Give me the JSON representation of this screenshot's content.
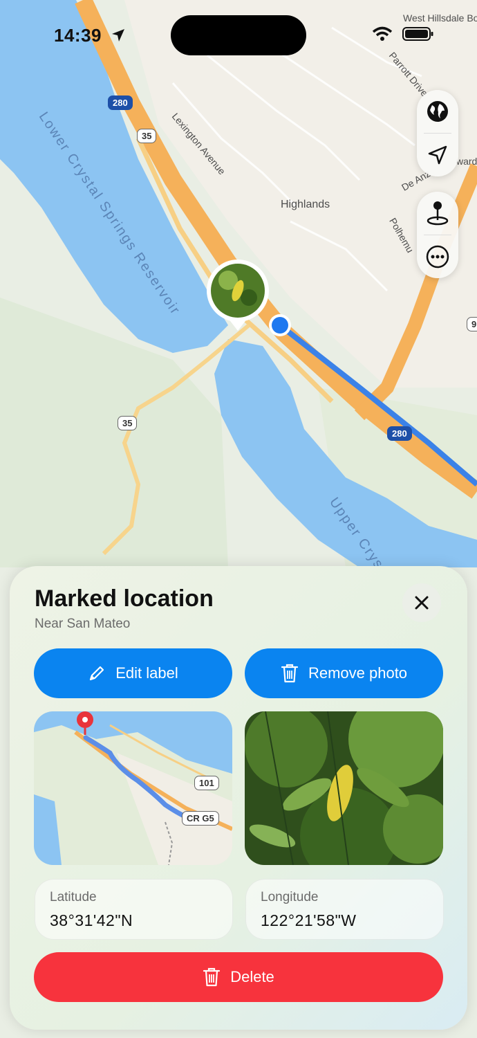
{
  "status_bar": {
    "time": "14:39"
  },
  "map": {
    "water_labels": [
      "Lower Crystal Springs Reservoir",
      "Upper Crys"
    ],
    "place_labels": [
      "Highlands",
      "Lexington Avenue",
      "West Hillsdale Bo",
      "Parrott Drive",
      "De Anz",
      "Polhemu",
      "ward"
    ],
    "highway_shields": [
      "280",
      "35",
      "35",
      "280",
      "9"
    ]
  },
  "map_controls": {
    "globe": "globe-icon",
    "location": "location-arrow-icon",
    "pin": "map-pin-icon",
    "more": "more-icon"
  },
  "sheet": {
    "title": "Marked location",
    "subtitle": "Near San Mateo",
    "edit_label": "Edit label",
    "remove_photo": "Remove photo",
    "mini_map_shields": [
      "101",
      "CR G5"
    ],
    "latitude_label": "Latitude",
    "latitude_value": "38°31'42\"N",
    "longitude_label": "Longitude",
    "longitude_value": "122°21'58\"W",
    "delete_label": "Delete"
  },
  "colors": {
    "accent": "#0a84f0",
    "destructive": "#f7333d",
    "water": "#8cc4f2",
    "highway": "#f5b15a"
  }
}
